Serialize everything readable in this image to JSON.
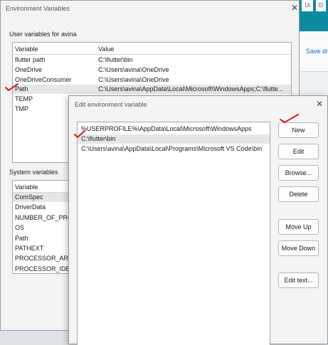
{
  "background_app": {
    "title_fragment": "Ui",
    "save_label": "Save dr"
  },
  "env_dialog": {
    "title": "Environment Variables",
    "user_section_label": "User variables for avina",
    "user_columns": [
      "Variable",
      "Value"
    ],
    "user_vars": [
      {
        "name": "flutter path",
        "value": "C:\\flutter\\bin"
      },
      {
        "name": "OneDrive",
        "value": "C:\\Users\\avina\\OneDrive"
      },
      {
        "name": "OneDriveConsumer",
        "value": "C:\\Users\\avina\\OneDrive"
      },
      {
        "name": "Path",
        "value": "C:\\Users\\avina\\AppData\\Local\\Microsoft\\WindowsApps;C:\\flutte..."
      },
      {
        "name": "TEMP",
        "value": ""
      },
      {
        "name": "TMP",
        "value": ""
      }
    ],
    "system_section_label": "System variables",
    "system_columns": [
      "Variable"
    ],
    "system_vars": [
      "ComSpec",
      "DriverData",
      "NUMBER_OF_PROCE",
      "OS",
      "Path",
      "PATHEXT",
      "PROCESSOR_ARCHI",
      "PROCESSOR_IDENTI"
    ]
  },
  "edit_dialog": {
    "title": "Edit environment variable",
    "entries": [
      "%USERPROFILE%\\AppData\\Local\\Microsoft\\WindowsApps",
      "C:\\flutter\\bin",
      "C:\\Users\\avina\\AppData\\Local\\Programs\\Microsoft VS Code\\bin"
    ],
    "buttons": {
      "new": "New",
      "edit": "Edit",
      "browse": "Browse...",
      "delete": "Delete",
      "move_up": "Move Up",
      "move_down": "Move Down",
      "edit_text": "Edit text..."
    }
  },
  "colors": {
    "accent_teal": "#0e8aa0",
    "annotation_red": "#d91c1c"
  },
  "icons": {
    "close": "close-icon",
    "annotation": "red-checkmark-icon"
  }
}
